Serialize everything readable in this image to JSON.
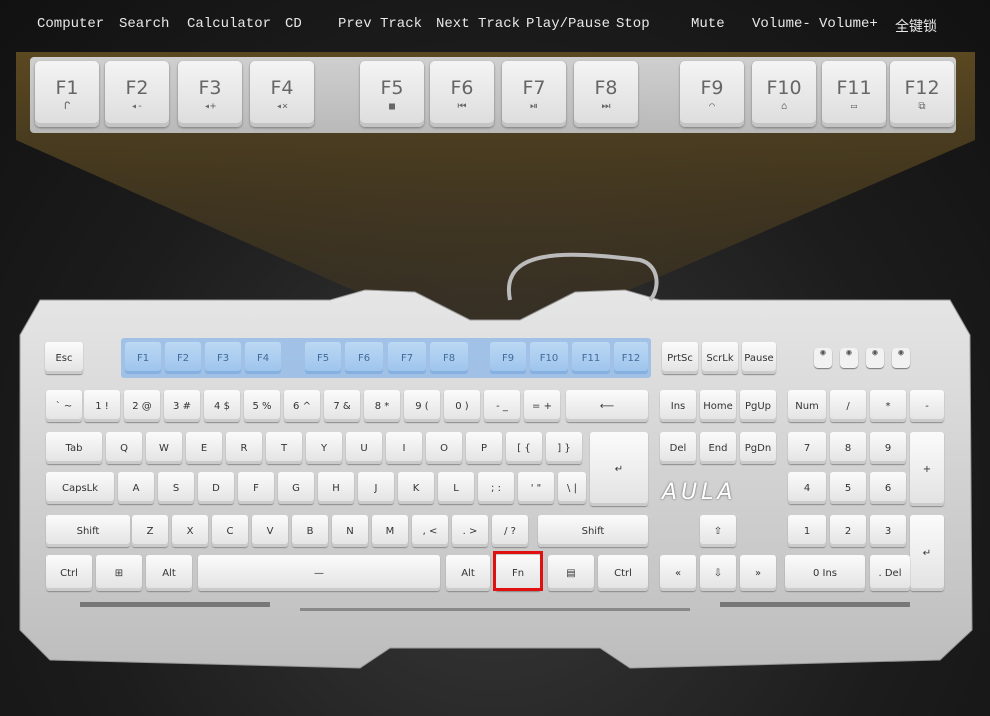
{
  "function_labels": [
    "Computer",
    "Search",
    "Calculator",
    "CD",
    "Prev Track",
    "Next Track",
    "Play/Pause",
    "Stop",
    "Mute",
    "Volume-",
    "Volume+",
    "全键锁"
  ],
  "zoom_keys": [
    {
      "key": "F1",
      "icon": "ᒋ"
    },
    {
      "key": "F2",
      "icon": "◂-"
    },
    {
      "key": "F3",
      "icon": "◂+"
    },
    {
      "key": "F4",
      "icon": "◂×"
    },
    {
      "key": "F5",
      "icon": "■"
    },
    {
      "key": "F6",
      "icon": "⏮"
    },
    {
      "key": "F7",
      "icon": "⏯"
    },
    {
      "key": "F8",
      "icon": "⏭"
    },
    {
      "key": "F9",
      "icon": "◠"
    },
    {
      "key": "F10",
      "icon": "⌂"
    },
    {
      "key": "F11",
      "icon": "▭"
    },
    {
      "key": "F12",
      "icon": "⧉"
    }
  ],
  "keyboard": {
    "brand": "AULA",
    "highlight_color": "#e01010",
    "highlighted_key": "Fn",
    "rows": [
      [
        "Esc",
        "F1",
        "F2",
        "F3",
        "F4",
        "F5",
        "F6",
        "F7",
        "F8",
        "F9",
        "F10",
        "F11",
        "F12",
        "PrtSc",
        "ScrLk",
        "Pause"
      ],
      [
        "` ~",
        "1 !",
        "2 @",
        "3 #",
        "4 $",
        "5 %",
        "6 ^",
        "7 &",
        "8 *",
        "9 (",
        "0 )",
        "- _",
        "= +",
        "⟵",
        "Ins",
        "Home",
        "PgUp",
        "Num",
        "/",
        "*",
        "-"
      ],
      [
        "Tab",
        "Q",
        "W",
        "E",
        "R",
        "T",
        "Y",
        "U",
        "I",
        "O",
        "P",
        "[ {",
        "] }",
        "↵",
        "Del",
        "End",
        "PgDn",
        "7",
        "8",
        "9",
        "+"
      ],
      [
        "CapsLk",
        "A",
        "S",
        "D",
        "F",
        "G",
        "H",
        "J",
        "K",
        "L",
        "; :",
        "' \"",
        "\\ |",
        "4",
        "5",
        "6"
      ],
      [
        "Shift",
        "Z",
        "X",
        "C",
        "V",
        "B",
        "N",
        "M",
        ", <",
        ". >",
        "/ ?",
        "Shift",
        "⇧",
        "1",
        "2",
        "3",
        "↵"
      ],
      [
        "Ctrl",
        "⊞",
        "Alt",
        "—",
        "Alt",
        "Fn",
        "▤",
        "Ctrl",
        "«",
        "⇩",
        "»",
        "0 Ins",
        ". Del"
      ]
    ]
  }
}
